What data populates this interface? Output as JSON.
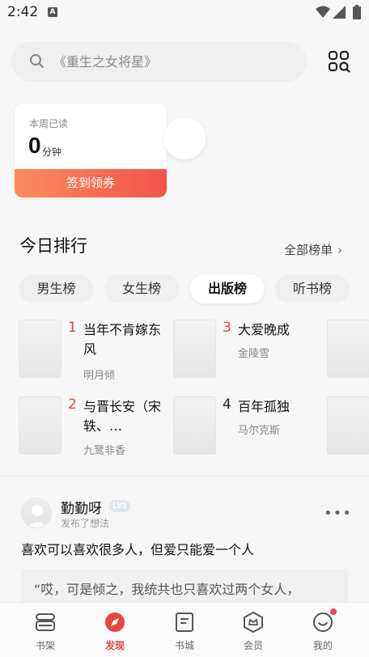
{
  "status": {
    "time": "2:42",
    "notif_icon": "A"
  },
  "search": {
    "placeholder": "《重生之女将星》"
  },
  "reading_card": {
    "label": "本周已读",
    "value": "0",
    "unit": "分钟",
    "button": "签到领券"
  },
  "ranking": {
    "title": "今日排行",
    "all_link": "全部榜单",
    "tabs": [
      "男生榜",
      "女生榜",
      "出版榜",
      "听书榜"
    ],
    "active_tab": "出版榜",
    "books": [
      {
        "rank": "1",
        "title": "当年不肯嫁东风",
        "author": "明月倾"
      },
      {
        "rank": "2",
        "title": "与晋长安（宋轶、…",
        "author": "九鹭非香"
      },
      {
        "rank": "3",
        "title": "大爱晚成",
        "author": "金陵雪"
      },
      {
        "rank": "4",
        "title": "百年孤独",
        "author": "马尔克斯"
      }
    ]
  },
  "post": {
    "username": "勤勤呀",
    "level": "LV1",
    "subtitle": "发布了想法",
    "text": "喜欢可以喜欢很多人，但爱只能爱一个人",
    "quote": "“哎，可是倾之，我统共也只喜欢过两个女人，"
  },
  "tabbar": {
    "items": [
      "书架",
      "发现",
      "书城",
      "会员",
      "我的"
    ],
    "active": "发现"
  },
  "colors": {
    "accent": "#e6463c",
    "sign_gradient_start": "#f98d5d",
    "sign_gradient_end": "#f4524b"
  }
}
